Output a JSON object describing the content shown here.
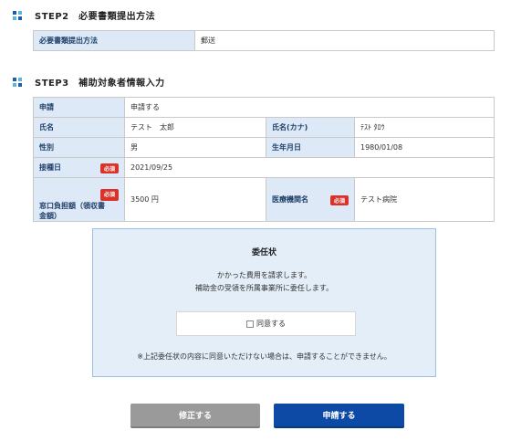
{
  "step2": {
    "title": "STEP2　必要書類提出方法",
    "rows": [
      {
        "label": "必要書類提出方法",
        "value": "郵送"
      }
    ]
  },
  "step3": {
    "title": "STEP3　補助対象者情報入力",
    "apply_label": "申請",
    "apply_value": "申請する",
    "name_label": "氏名",
    "name_value": "テスト　太郎",
    "kana_label": "氏名(カナ)",
    "kana_value": "ﾃｽﾄ ﾀﾛｳ",
    "gender_label": "性別",
    "gender_value": "男",
    "birth_label": "生年月日",
    "birth_value": "1980/01/08",
    "visit_label": "接種日",
    "visit_value": "2021/09/25",
    "cost_label": "窓口負担額（領収書金額）",
    "cost_value": "3500 円",
    "hospital_label": "医療機関名",
    "hospital_value": "テスト病院",
    "required_badge": "必須"
  },
  "consent": {
    "title": "委任状",
    "line1": "かかった費用を請求します。",
    "line2": "補助金の受領を所属事業所に委任します。",
    "checkbox_label": "同意する",
    "checked": false,
    "note": "※上記委任状の内容に同意いただけない場合は、申請することができません。"
  },
  "buttons": {
    "edit": "修正する",
    "apply": "申請する"
  },
  "colors": {
    "header_cell": "#dde9f6",
    "required": "#d9322a",
    "primary": "#0c4aa6",
    "secondary": "#9a9a9a",
    "consent_bg": "#e3eef9"
  }
}
